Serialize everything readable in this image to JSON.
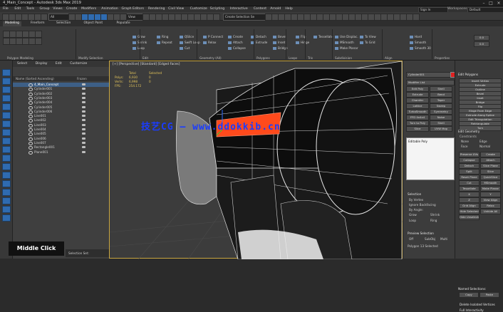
{
  "window": {
    "title": "4_Main_Concept - Autodesk 3ds Max 2019"
  },
  "menubar": {
    "items": [
      "File",
      "Edit",
      "Tools",
      "Group",
      "Views",
      "Create",
      "Modifiers",
      "Animation",
      "Graph Editors",
      "Rendering",
      "Civil View",
      "Customize",
      "Scripting",
      "Interactive",
      "Content",
      "Arnold",
      "Help"
    ],
    "user": "Sign In",
    "workspaces_label": "Workspaces:",
    "workspace": "Default"
  },
  "toolbar": {
    "selection_filter": "All",
    "view": "View",
    "selection_set": "Create Selection Se"
  },
  "ribbon": {
    "tabs": [
      "Modeling",
      "Freeform",
      "Selection",
      "Object Paint",
      "Populate"
    ],
    "active_tab": "Modeling",
    "panels": [
      "Polygon Modeling",
      "Modify Selection",
      "Edit",
      "Geometry (All)",
      "Polygons",
      "Loops",
      "Tris",
      "Subdivision",
      "Align",
      "Properties"
    ],
    "items": [
      "Grow",
      "Shrink",
      "Loop",
      "Ring",
      "Repeat",
      "QSlice",
      "Swift Loop",
      "Cut",
      "P Connect",
      "Relax",
      "Create",
      "Attach",
      "Collapse",
      "Detach",
      "Extrude",
      "Bevel",
      "Inset",
      "Bridge",
      "Flip",
      "Hinge",
      "Tessellate",
      "Use Displac.",
      "MSmooth",
      "Make Planar",
      "To View",
      "To Grid",
      "Hard",
      "Smooth",
      "Smooth 30"
    ],
    "color_values": [
      "0.0",
      "0.0"
    ]
  },
  "scene_explorer": {
    "menu": [
      "Select",
      "Display",
      "Edit",
      "Customize"
    ],
    "columns": [
      "Name (Sorted Ascending)",
      "Frozen"
    ],
    "rows": [
      "4_Main_Concept",
      "Cylinder001",
      "Cylinder002",
      "Cylinder003",
      "Cylinder004",
      "Cylinder005",
      "Cylinder006",
      "Line001",
      "Line002",
      "Line003",
      "Line004",
      "Line005",
      "Line006",
      "Line007",
      "Rectangle001",
      "Plane001"
    ],
    "selected_index": 0,
    "caption": "Middle Click",
    "status": "Selection Set:"
  },
  "viewport": {
    "label": "[+] [Perspective] [Standard] [Edged Faces]",
    "stats": {
      "header": "Total",
      "selected_label": "Selected",
      "rows": [
        [
          "Polys:",
          "6,930",
          "0"
        ],
        [
          "Verts:",
          "6,998",
          "0"
        ],
        [
          "FPS:",
          "254.172",
          ""
        ]
      ]
    },
    "watermark": "技艺CG — www.ddokkib.cn",
    "colors": {
      "highlight": "#ff4a1c",
      "selection_border": "#c9a640",
      "mesh": "#0e0e0e",
      "edge": "#e8e8e8"
    }
  },
  "command_panel_left": {
    "name_field": "Cylinder001",
    "modifier_list": "Modifier List",
    "buttons": [
      "Edit Poly",
      "Shell",
      "Extrude",
      "Bend",
      "Chamfer",
      "Taper",
      "Lattice",
      "Sweep",
      "TurboSmooth",
      "Symmetry",
      "FFD 4x4x4",
      "Noise",
      "Turn to Poly",
      "Shell",
      "Slice",
      "UVW Map"
    ],
    "stack_item": "Editable Poly",
    "soft_selection": {
      "title": "Selection",
      "options": [
        "By Vertex",
        "Ignore Backfacing",
        "By Angle:",
        "Shrink",
        "Grow",
        "Ring",
        "Loop"
      ],
      "angle": "45.0",
      "preview_title": "Preview Selection",
      "preview_options": [
        "Off",
        "SubObj",
        "Multi"
      ],
      "status": "Polygon 13 Selected"
    }
  },
  "command_panel_right": {
    "title": "Edit Polygons",
    "buttons": [
      "Insert Vertex",
      "Extrude",
      "Outline",
      "Bevel",
      "Inset",
      "Bridge",
      "Flip",
      "Hinge From Edge",
      "Extrude Along Spline",
      "Edit Triangulation",
      "Retriangulate",
      "Turn"
    ],
    "edit_geometry_title": "Edit Geometry",
    "constraints_label": "Constraints",
    "constraints": [
      "None",
      "Edge",
      "Face",
      "Normal"
    ],
    "extra": [
      "Preserve UVs",
      "Create",
      "Collapse",
      "Attach",
      "Detach",
      "Slice Plane",
      "Split",
      "Slice",
      "Reset Plane",
      "QuickSlice",
      "Cut",
      "MSmooth",
      "Tessellate",
      "Make Planar",
      "X",
      "Y",
      "Z",
      "View Align",
      "Grid Align",
      "Relax",
      "Hide Selected",
      "Unhide All",
      "Hide Unselected"
    ],
    "named_selections": "Named Selections:",
    "copy_paste": [
      "Copy",
      "Paste"
    ],
    "checks": [
      "Delete Isolated Vertices",
      "Full Interactivity"
    ]
  }
}
